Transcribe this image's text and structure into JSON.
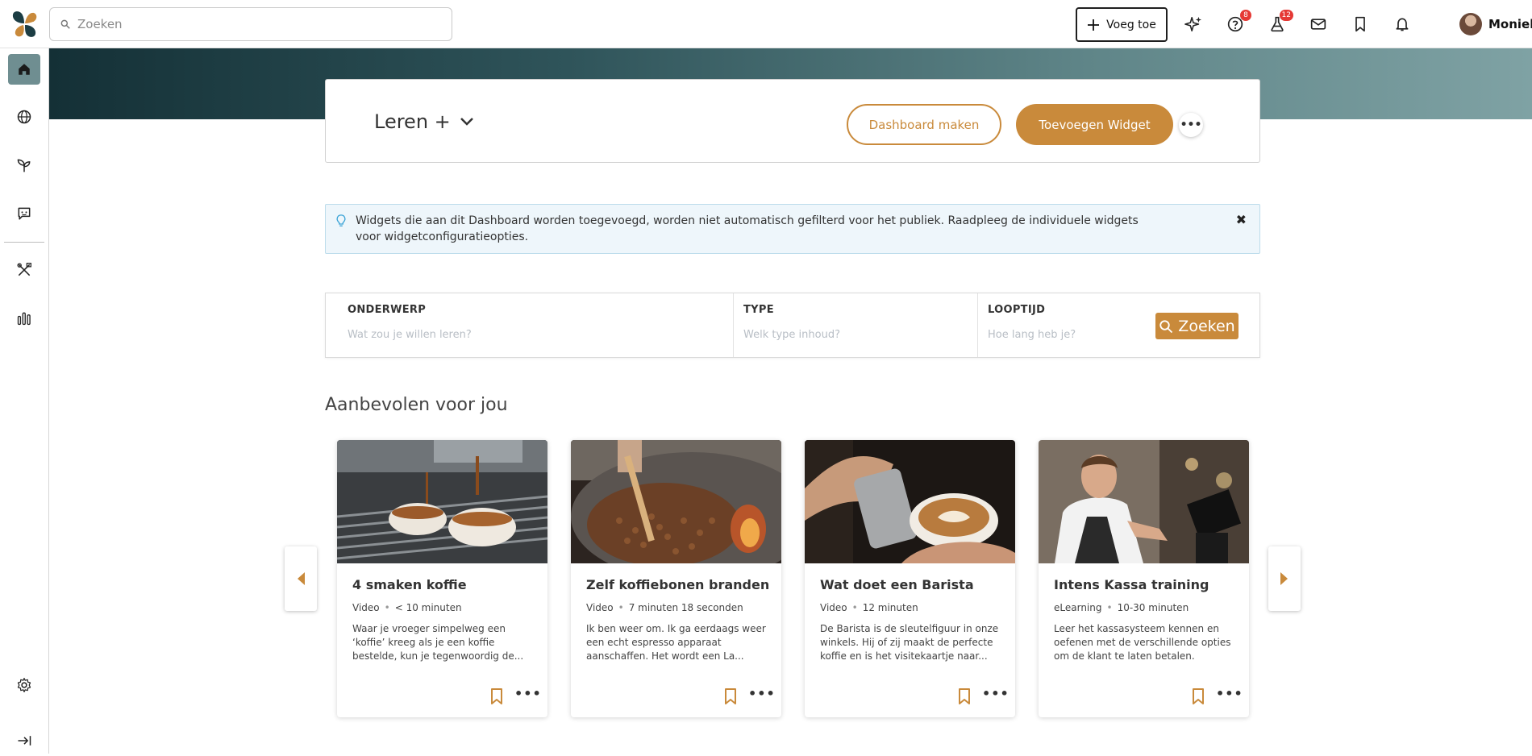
{
  "topbar": {
    "search_placeholder": "Zoeken",
    "add_label": "Voeg toe",
    "help_badge": "8",
    "lab_badge": "12",
    "user_name": "Moniek"
  },
  "sidebar": {
    "items": [
      "home-icon",
      "globe-icon",
      "sprout-icon",
      "chat-icon",
      "tools-icon",
      "bar-chart-icon",
      "gear-icon",
      "collapse-icon"
    ]
  },
  "dashboard": {
    "title": "Leren +",
    "btn_make": "Dashboard maken",
    "btn_add_widget": "Toevoegen Widget"
  },
  "info": {
    "text": "Widgets die aan dit Dashboard worden toegevoegd, worden niet automatisch gefilterd voor het publiek. Raadpleeg de individuele widgets voor widgetconfiguratieopties."
  },
  "filters": {
    "subject_label": "ONDERWERP",
    "subject_placeholder": "Wat zou je willen leren?",
    "type_label": "TYPE",
    "type_placeholder": "Welk type inhoud?",
    "duration_label": "LOOPTIJD",
    "duration_placeholder": "Hoe lang heb je?",
    "search_label": "Zoeken"
  },
  "recommended": {
    "title": "Aanbevolen voor jou",
    "cards": [
      {
        "title": "4 smaken koffie",
        "type": "Video",
        "duration": "< 10 minuten",
        "desc": "Waar je vroeger simpelweg een ‘koffie’ kreeg als je een koffie bestelde, kun je tegenwoordig de..."
      },
      {
        "title": "Zelf koffiebonen branden",
        "type": "Video",
        "duration": "7 minuten 18 seconden",
        "desc": "Ik ben weer om. Ik ga eerdaags weer een echt espresso apparaat aanschaffen. Het wordt een La..."
      },
      {
        "title": "Wat doet een Barista",
        "type": "Video",
        "duration": "12 minuten",
        "desc": "De Barista is de sleutelfiguur in onze winkels. Hij of zij maakt de perfecte koffie en is het visitekaartje naar..."
      },
      {
        "title": "Intens Kassa training",
        "type": "eLearning",
        "duration": "10-30 minuten",
        "desc": "Leer het kassasysteem kennen en oefenen met de verschillende opties om de klant te laten betalen."
      }
    ]
  },
  "colors": {
    "accent": "#c98a3b",
    "sidebar_active": "#6f8e91",
    "banner_dark": "#143036",
    "info_bg": "#eef6fb"
  }
}
